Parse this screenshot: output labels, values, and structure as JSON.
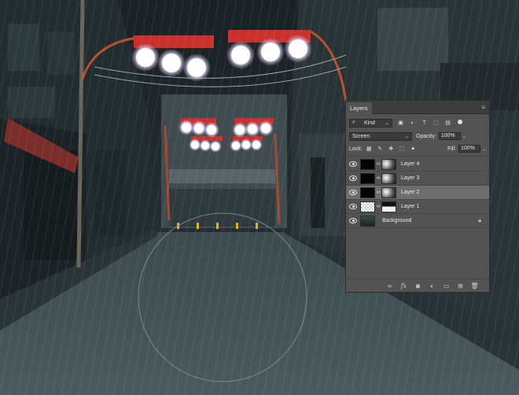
{
  "panel": {
    "title": "Layers",
    "menu_icon": "panel-menu-icon",
    "filter": {
      "kind_label": "Kind",
      "icons": [
        "image-filter-icon",
        "adjustment-filter-icon",
        "type-filter-icon",
        "shape-filter-icon",
        "smart-object-filter-icon",
        "filter-toggle-icon"
      ]
    },
    "blend_mode": "Screen",
    "opacity_label": "Opacity:",
    "opacity_value": "100%",
    "lock_label": "Lock:",
    "lock_icons": [
      "lock-transparent-icon",
      "lock-image-icon",
      "lock-position-icon",
      "lock-artboard-icon",
      "lock-all-icon"
    ],
    "fill_label": "Fill:",
    "fill_value": "100%",
    "layers": [
      {
        "name": "Layer 4",
        "thumb": "black",
        "mask": "cloud",
        "selected": false,
        "locked": false
      },
      {
        "name": "Layer 3",
        "thumb": "black",
        "mask": "cloud",
        "selected": false,
        "locked": false
      },
      {
        "name": "Layer 2",
        "thumb": "black",
        "mask": "cloud",
        "selected": true,
        "locked": false
      },
      {
        "name": "Layer 1",
        "thumb": "checker",
        "mask": "mask1",
        "selected": false,
        "locked": false
      },
      {
        "name": "Background",
        "thumb": "bg",
        "mask": null,
        "selected": false,
        "locked": true
      }
    ],
    "footer_icons": [
      "link-layers-icon",
      "fx-icon",
      "add-mask-icon",
      "adjustment-layer-icon",
      "new-group-icon",
      "new-layer-icon",
      "trash-icon"
    ]
  },
  "colors": {
    "panel_bg": "#535353",
    "panel_header": "#3d3d3d",
    "selected_row": "#6e6e6e",
    "lantern_red": "#c8312c"
  }
}
